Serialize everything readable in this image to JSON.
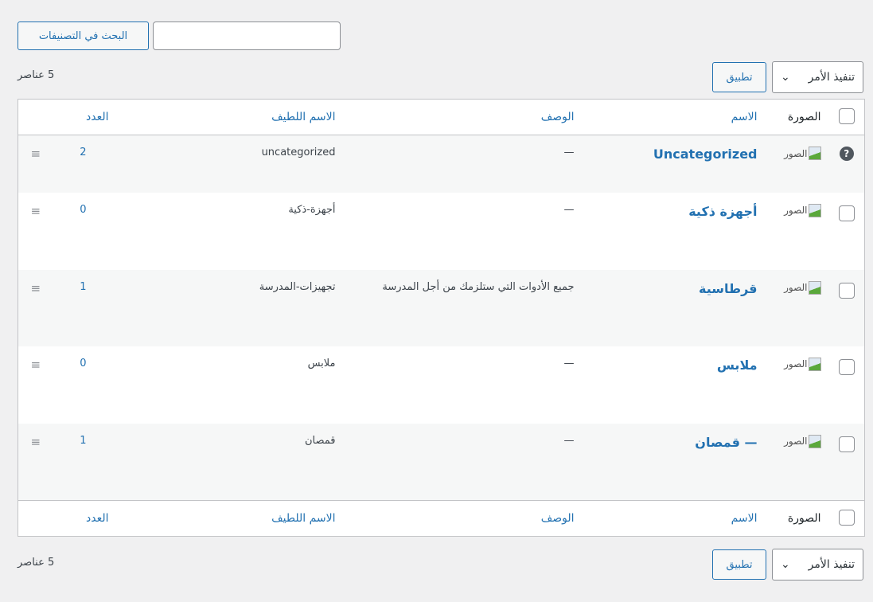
{
  "search": {
    "value": "",
    "button": "البحث في التصنيفات"
  },
  "bulk": {
    "selected": "تنفيذ الأمر",
    "apply": "تطبيق",
    "count": "5 عناصر"
  },
  "columns": {
    "image": "الصورة",
    "name": "الاسم",
    "description": "الوصف",
    "slug": "الاسم اللطيف",
    "count": "العدد"
  },
  "rows": [
    {
      "image_alt": "الصور",
      "name": "Uncategorized",
      "description": "—",
      "slug": "uncategorized",
      "count": "2"
    },
    {
      "image_alt": "الصور",
      "name": "أجهزة ذكية",
      "description": "—",
      "slug": "أجهزة-ذكية",
      "count": "0"
    },
    {
      "image_alt": "الصور",
      "name": "قرطاسية",
      "description": "جميع الأدوات التي ستلزمك من أجل المدرسة",
      "slug": "تجهيزات-المدرسة",
      "count": "1"
    },
    {
      "image_alt": "الصور",
      "name": "ملابس",
      "description": "—",
      "slug": "ملابس",
      "count": "0"
    },
    {
      "image_alt": "الصور",
      "name": "— قمصان",
      "description": "—",
      "slug": "قمصان",
      "count": "1"
    }
  ],
  "icons": {
    "help": "?",
    "handle": "≡",
    "chevron": "⌄"
  }
}
